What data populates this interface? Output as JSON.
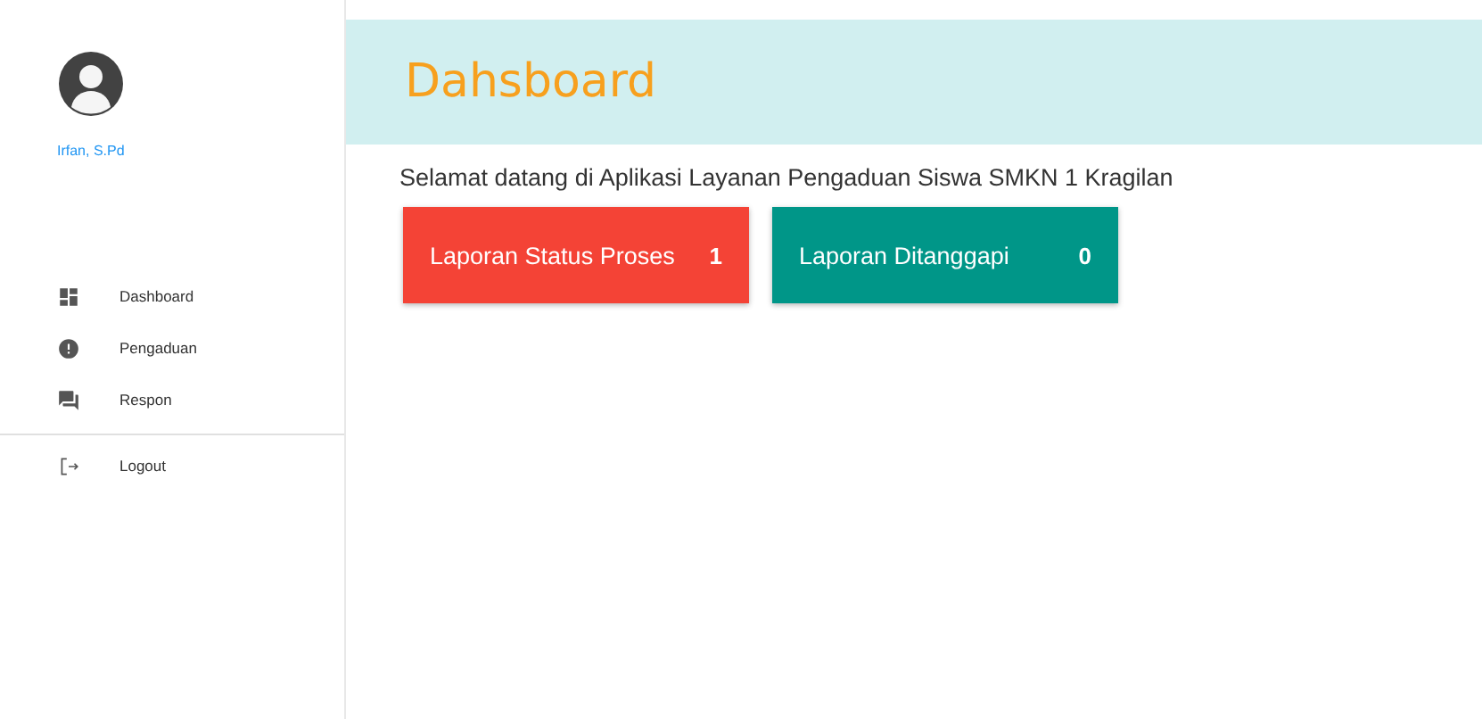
{
  "sidebar": {
    "user_name": "Irfan, S.Pd",
    "items": [
      {
        "kind": "dashboard",
        "label": "Dashboard"
      },
      {
        "kind": "alert",
        "label": "Pengaduan"
      },
      {
        "kind": "chat",
        "label": "Respon"
      }
    ],
    "footer_items": [
      {
        "kind": "logout",
        "label": "Logout"
      }
    ]
  },
  "header": {
    "title": "Dahsboard"
  },
  "welcome": "Selamat datang di Aplikasi Layanan Pengaduan Siswa SMKN 1 Kragilan",
  "cards": [
    {
      "label": "Laporan Status Proses",
      "count": "1",
      "color": "#f44336"
    },
    {
      "label": "Laporan Ditanggapi",
      "count": "0",
      "color": "#009688"
    }
  ]
}
